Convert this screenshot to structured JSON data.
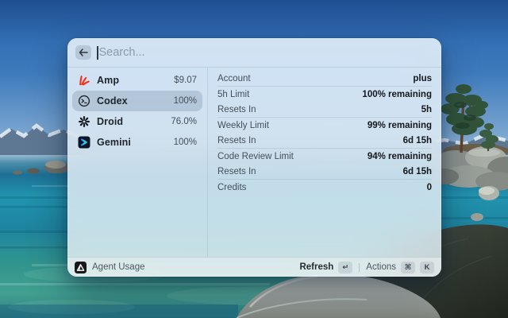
{
  "search": {
    "placeholder": "Search..."
  },
  "list": {
    "items": [
      {
        "name": "Amp",
        "value": "$9.07",
        "icon": "amp-icon",
        "selected": false
      },
      {
        "name": "Codex",
        "value": "100%",
        "icon": "codex-icon",
        "selected": true
      },
      {
        "name": "Droid",
        "value": "76.0%",
        "icon": "droid-icon",
        "selected": false
      },
      {
        "name": "Gemini",
        "value": "100%",
        "icon": "gemini-icon",
        "selected": false
      }
    ]
  },
  "detail": {
    "groups": [
      {
        "rows": [
          {
            "label": "Account",
            "value": "plus"
          }
        ]
      },
      {
        "rows": [
          {
            "label": "5h Limit",
            "value": "100% remaining"
          },
          {
            "label": "Resets In",
            "value": "5h"
          }
        ]
      },
      {
        "rows": [
          {
            "label": "Weekly Limit",
            "value": "99% remaining"
          },
          {
            "label": "Resets In",
            "value": "6d 15h"
          }
        ]
      },
      {
        "rows": [
          {
            "label": "Code Review Limit",
            "value": "94% remaining"
          },
          {
            "label": "Resets In",
            "value": "6d 15h"
          }
        ]
      },
      {
        "rows": [
          {
            "label": "Credits",
            "value": "0"
          }
        ]
      }
    ]
  },
  "statusbar": {
    "app_name": "Agent Usage",
    "app_icon": "agent-usage-logo-icon",
    "refresh_label": "Refresh",
    "refresh_key": "↵",
    "actions_label": "Actions",
    "actions_key_1": "⌘",
    "actions_key_2": "K"
  },
  "colors": {
    "amp_red": "#f42f15",
    "gemini_teal": "#29d2da",
    "gemini_blue": "#2f6bff",
    "selection": "rgba(112,136,158,0.30)",
    "window_tint": "#e0ecf5"
  }
}
